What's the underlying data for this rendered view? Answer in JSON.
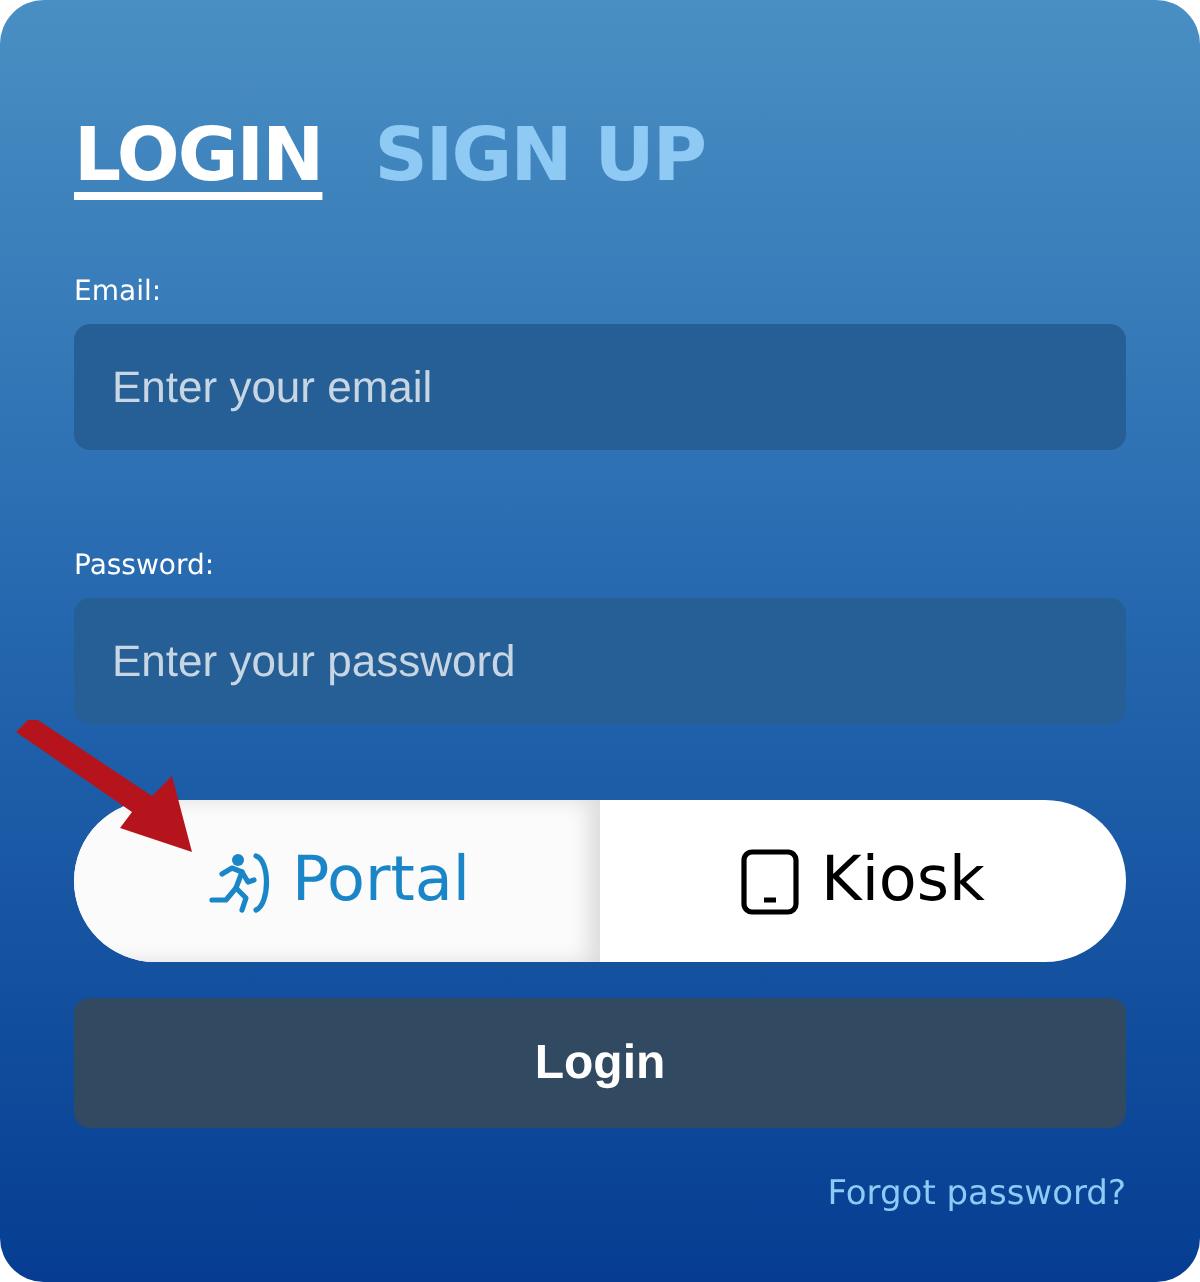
{
  "tabs": [
    {
      "label": "LOGIN",
      "selected": true
    },
    {
      "label": "SIGN UP",
      "selected": false
    }
  ],
  "fields": [
    {
      "label": "Email:",
      "placeholder": "Enter your email"
    },
    {
      "label": "Password:",
      "placeholder": "Enter your password"
    }
  ],
  "mode_toggle": [
    {
      "kind": "portal",
      "label": "Portal",
      "selected": true
    },
    {
      "kind": "kiosk",
      "label": "Kiosk",
      "selected": false
    }
  ],
  "submit": "Login",
  "forgot_link": "Forgot password?"
}
